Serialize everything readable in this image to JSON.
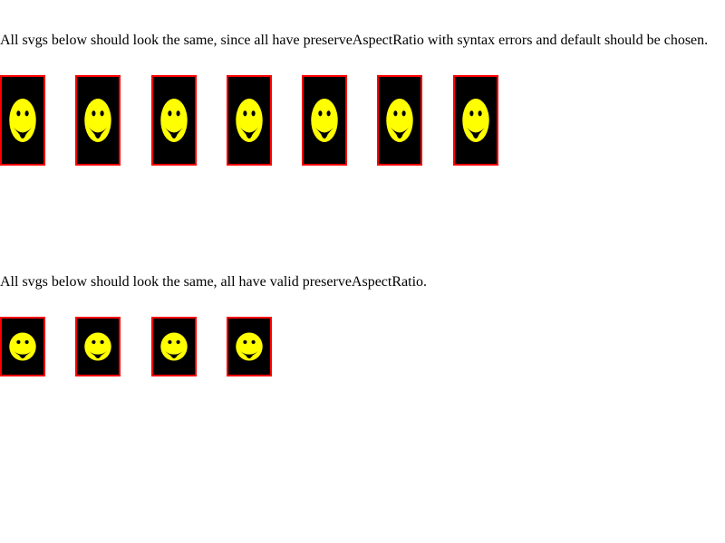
{
  "section_invalid": {
    "caption": "All svgs below should look the same, since all have preserveAspectRatio with syntax errors and default should be chosen.",
    "tiles": [
      {
        "icon": "smiley-face-icon"
      },
      {
        "icon": "smiley-face-icon"
      },
      {
        "icon": "smiley-face-icon"
      },
      {
        "icon": "smiley-face-icon"
      },
      {
        "icon": "smiley-face-icon"
      },
      {
        "icon": "smiley-face-icon"
      },
      {
        "icon": "smiley-face-icon"
      }
    ]
  },
  "section_valid": {
    "caption": "All svgs below should look the same, all have valid preserveAspectRatio.",
    "tiles": [
      {
        "icon": "smiley-face-icon"
      },
      {
        "icon": "smiley-face-icon"
      },
      {
        "icon": "smiley-face-icon"
      },
      {
        "icon": "smiley-face-icon"
      }
    ]
  },
  "colors": {
    "tile_background": "#000000",
    "tile_border": "#ff0000",
    "face_fill": "#ffff00",
    "features": "#000000"
  }
}
